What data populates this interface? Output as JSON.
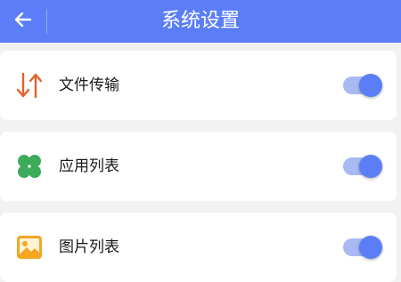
{
  "header": {
    "title": "系统设置",
    "back_icon": "arrow-left-icon",
    "background": "#5b7ef7"
  },
  "settings": [
    {
      "label": "文件传输",
      "icon": "transfer-arrows-icon",
      "icon_color": "#e2622b",
      "enabled": true
    },
    {
      "label": "应用列表",
      "icon": "four-leaf-icon",
      "icon_color": "#3daa5c",
      "enabled": true
    },
    {
      "label": "图片列表",
      "icon": "image-icon",
      "icon_color": "#f5a623",
      "enabled": true
    }
  ],
  "toggle_color": "#5b7ef7"
}
